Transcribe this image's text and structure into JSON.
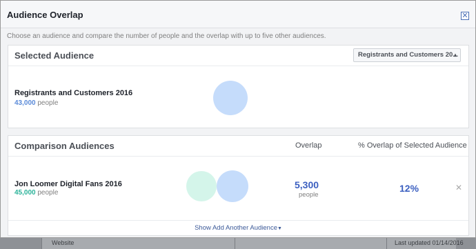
{
  "dialog": {
    "title": "Audience Overlap",
    "close_icon": "close-icon",
    "description": "Choose an audience and compare the number of people and the overlap with up to five other audiences."
  },
  "selected": {
    "heading": "Selected Audience",
    "dropdown_value": "Registrants and Customers 20...",
    "audience_name": "Registrants and Customers 2016",
    "audience_size": "43,000",
    "size_unit": "people",
    "circle_color": "#c5dcfb"
  },
  "comparison": {
    "heading": "Comparison Audiences",
    "col_overlap": "Overlap",
    "col_percent": "% Overlap of Selected Audience",
    "audience_name": "Jon Loomer Digital Fans 2016",
    "audience_size": "45,000",
    "size_unit": "people",
    "overlap_value": "5,300",
    "overlap_unit": "people",
    "percent_value": "12%",
    "remove_icon": "close-icon",
    "footer_link": "Show Add Another Audience",
    "left_circle_color": "#d4f5ea",
    "right_circle_color": "#c5dcfb",
    "intersection_color": "#3b6fd0"
  },
  "background": {
    "left_text": "Website",
    "right_text": "Last updated 01/14/2016"
  }
}
